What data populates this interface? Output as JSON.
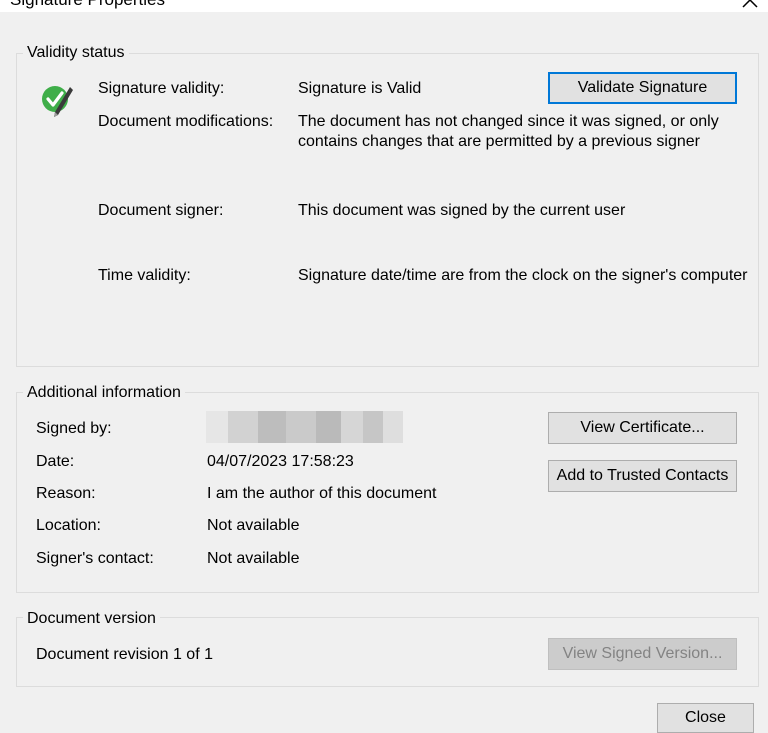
{
  "window": {
    "title": "Signature Properties",
    "close_icon": "close-icon"
  },
  "validity": {
    "group_title": "Validity status",
    "status_icon": "valid-signature-check-icon",
    "signature_validity_label": "Signature validity:",
    "signature_validity_value": "Signature is Valid",
    "validate_button": "Validate Signature",
    "modifications_label": "Document modifications:",
    "modifications_value_line1": "The document has not changed since it was signed, or only",
    "modifications_value_line2": "contains changes that are permitted by a previous signer",
    "signer_label": "Document signer:",
    "signer_value": "This document was signed by the current user",
    "time_label": "Time validity:",
    "time_value": "Signature date/time are from the clock on the signer's computer"
  },
  "additional": {
    "group_title": "Additional information",
    "signed_by_label": "Signed by:",
    "date_label": "Date:",
    "date_value": "04/07/2023 17:58:23",
    "reason_label": "Reason:",
    "reason_value": "I am the author of this document",
    "location_label": "Location:",
    "location_value": "Not available",
    "contact_label": "Signer's contact:",
    "contact_value": "Not available",
    "view_certificate_button": "View Certificate...",
    "add_trusted_button": "Add to Trusted Contacts"
  },
  "version": {
    "group_title": "Document version",
    "revision_text": "Document revision 1 of 1",
    "view_signed_button": "View Signed Version..."
  },
  "footer": {
    "close_button": "Close"
  }
}
